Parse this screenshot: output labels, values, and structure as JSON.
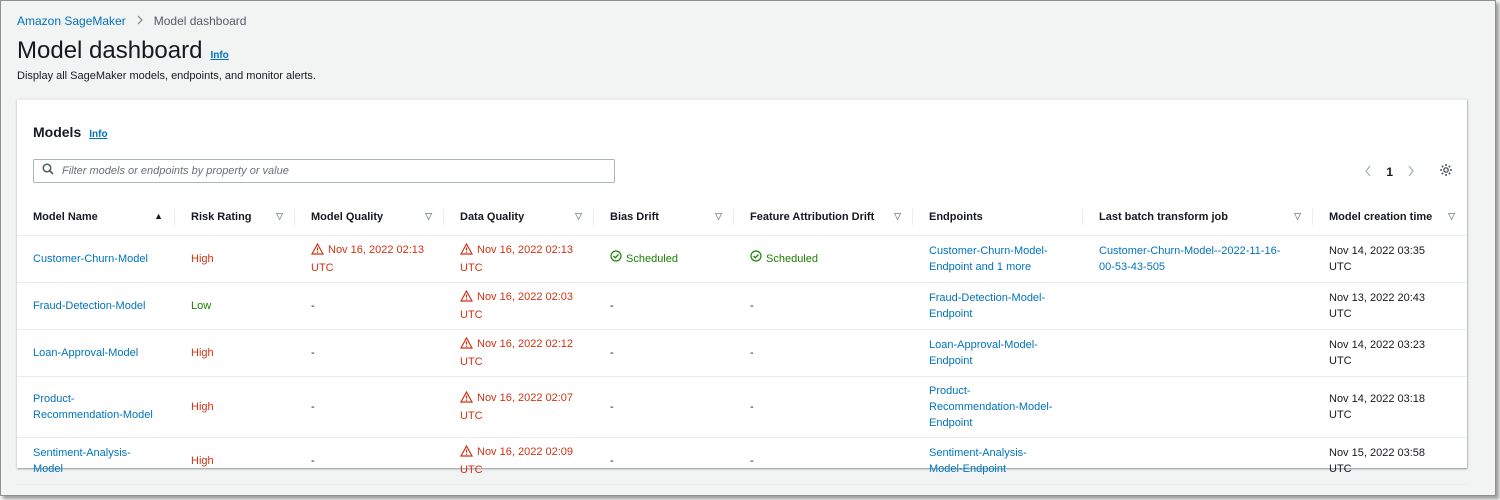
{
  "breadcrumb": {
    "root": "Amazon SageMaker",
    "current": "Model dashboard"
  },
  "page": {
    "title": "Model dashboard",
    "info": "Info",
    "subtitle": "Display all SageMaker models, endpoints, and monitor alerts."
  },
  "models": {
    "title": "Models",
    "info": "Info",
    "filter_placeholder": "Filter models or endpoints by property or value",
    "page_number": "1",
    "columns": [
      "Model Name",
      "Risk Rating",
      "Model Quality",
      "Data Quality",
      "Bias Drift",
      "Feature Attribution Drift",
      "Endpoints",
      "Last batch transform job",
      "Model creation time"
    ],
    "rows": [
      {
        "name": "Customer-Churn-Model",
        "risk": "High",
        "model_quality_1": "Nov 16, 2022 02:13",
        "model_quality_2": "UTC",
        "data_quality_1": "Nov 16, 2022 02:13",
        "data_quality_2": "UTC",
        "bias_drift": "Scheduled",
        "feature_drift": "Scheduled",
        "endpoint_1": "Customer-Churn-Model-",
        "endpoint_2": "Endpoint and 1 more",
        "batch_1": "Customer-Churn-Model--2022-11-16-",
        "batch_2": "00-53-43-505",
        "created_1": "Nov 14, 2022 03:35",
        "created_2": "UTC"
      },
      {
        "name": "Fraud-Detection-Model",
        "risk": "Low",
        "model_quality": "-",
        "data_quality_1": "Nov 16, 2022 02:03",
        "data_quality_2": "UTC",
        "bias_drift": "-",
        "feature_drift": "-",
        "endpoint_1": "Fraud-Detection-Model-",
        "endpoint_2": "Endpoint",
        "created_1": "Nov 13, 2022 20:43",
        "created_2": "UTC"
      },
      {
        "name": "Loan-Approval-Model",
        "risk": "High",
        "model_quality": "-",
        "data_quality_1": "Nov 16, 2022 02:12",
        "data_quality_2": "UTC",
        "bias_drift": "-",
        "feature_drift": "-",
        "endpoint_1": "Loan-Approval-Model-",
        "endpoint_2": "Endpoint",
        "created_1": "Nov 14, 2022 03:23",
        "created_2": "UTC"
      },
      {
        "name_1": "Product-",
        "name_2": "Recommendation-Model",
        "risk": "High",
        "model_quality": "-",
        "data_quality_1": "Nov 16, 2022 02:07",
        "data_quality_2": "UTC",
        "bias_drift": "-",
        "feature_drift": "-",
        "endpoint_1": "Product-",
        "endpoint_2": "Recommendation-Model-",
        "endpoint_3": "Endpoint",
        "created_1": "Nov 14, 2022 03:18",
        "created_2": "UTC"
      },
      {
        "name_1": "Sentiment-Analysis-",
        "name_2": "Model",
        "risk": "High",
        "model_quality": "-",
        "data_quality_1": "Nov 16, 2022 02:09",
        "data_quality_2": "UTC",
        "bias_drift": "-",
        "feature_drift": "-",
        "endpoint_1": "Sentiment-Analysis-",
        "endpoint_2": "Model-Endpoint",
        "created_1": "Nov 15, 2022 03:58",
        "created_2": "UTC"
      }
    ]
  },
  "colors": {
    "link": "#0073bb",
    "alert": "#d13212",
    "success": "#1d8102"
  }
}
